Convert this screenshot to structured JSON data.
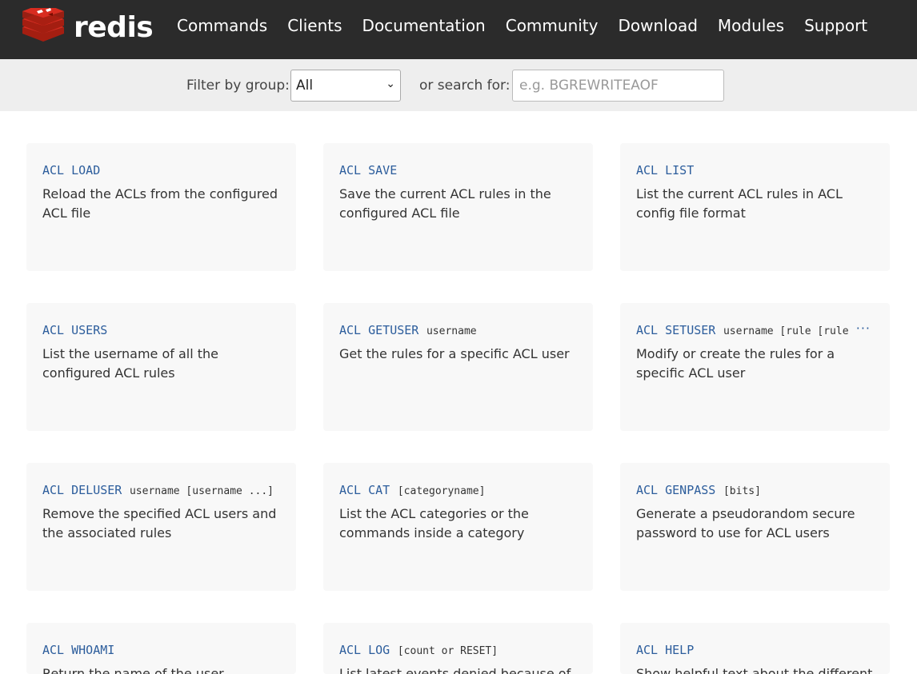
{
  "brand": {
    "name": "redis"
  },
  "nav": [
    {
      "label": "Commands"
    },
    {
      "label": "Clients"
    },
    {
      "label": "Documentation"
    },
    {
      "label": "Community"
    },
    {
      "label": "Download"
    },
    {
      "label": "Modules"
    },
    {
      "label": "Support"
    }
  ],
  "filter": {
    "group_label": "Filter by group:",
    "group_value": "All",
    "search_label": "or search for:",
    "search_placeholder": "e.g. BGREWRITEAOF",
    "search_value": ""
  },
  "commands": [
    {
      "name": "ACL LOAD",
      "args": "",
      "desc": "Reload the ACLs from the configured ACL file"
    },
    {
      "name": "ACL SAVE",
      "args": "",
      "desc": "Save the current ACL rules in the configured ACL file"
    },
    {
      "name": "ACL LIST",
      "args": "",
      "desc": "List the current ACL rules in ACL config file format"
    },
    {
      "name": "ACL USERS",
      "args": "",
      "desc": "List the username of all the configured ACL rules"
    },
    {
      "name": "ACL GETUSER",
      "args": "username",
      "desc": "Get the rules for a specific ACL user"
    },
    {
      "name": "ACL SETUSER",
      "args": "username [rule [rule",
      "more": "···",
      "desc": "Modify or create the rules for a specific ACL user"
    },
    {
      "name": "ACL DELUSER",
      "args": "username [username ...]",
      "desc": "Remove the specified ACL users and the associated rules"
    },
    {
      "name": "ACL CAT",
      "args": "[categoryname]",
      "desc": "List the ACL categories or the commands inside a category"
    },
    {
      "name": "ACL GENPASS",
      "args": "[bits]",
      "desc": "Generate a pseudorandom secure password to use for ACL users"
    },
    {
      "name": "ACL WHOAMI",
      "args": "",
      "desc": "Return the name of the user associated"
    },
    {
      "name": "ACL LOG",
      "args": "[count or RESET]",
      "desc": "List latest events denied because of"
    },
    {
      "name": "ACL HELP",
      "args": "",
      "desc": "Show helpful text about the different"
    }
  ],
  "colors": {
    "nav_bg": "#2b2b2b",
    "command_link": "#2c5d9c",
    "brand_red": "#d82c20"
  }
}
